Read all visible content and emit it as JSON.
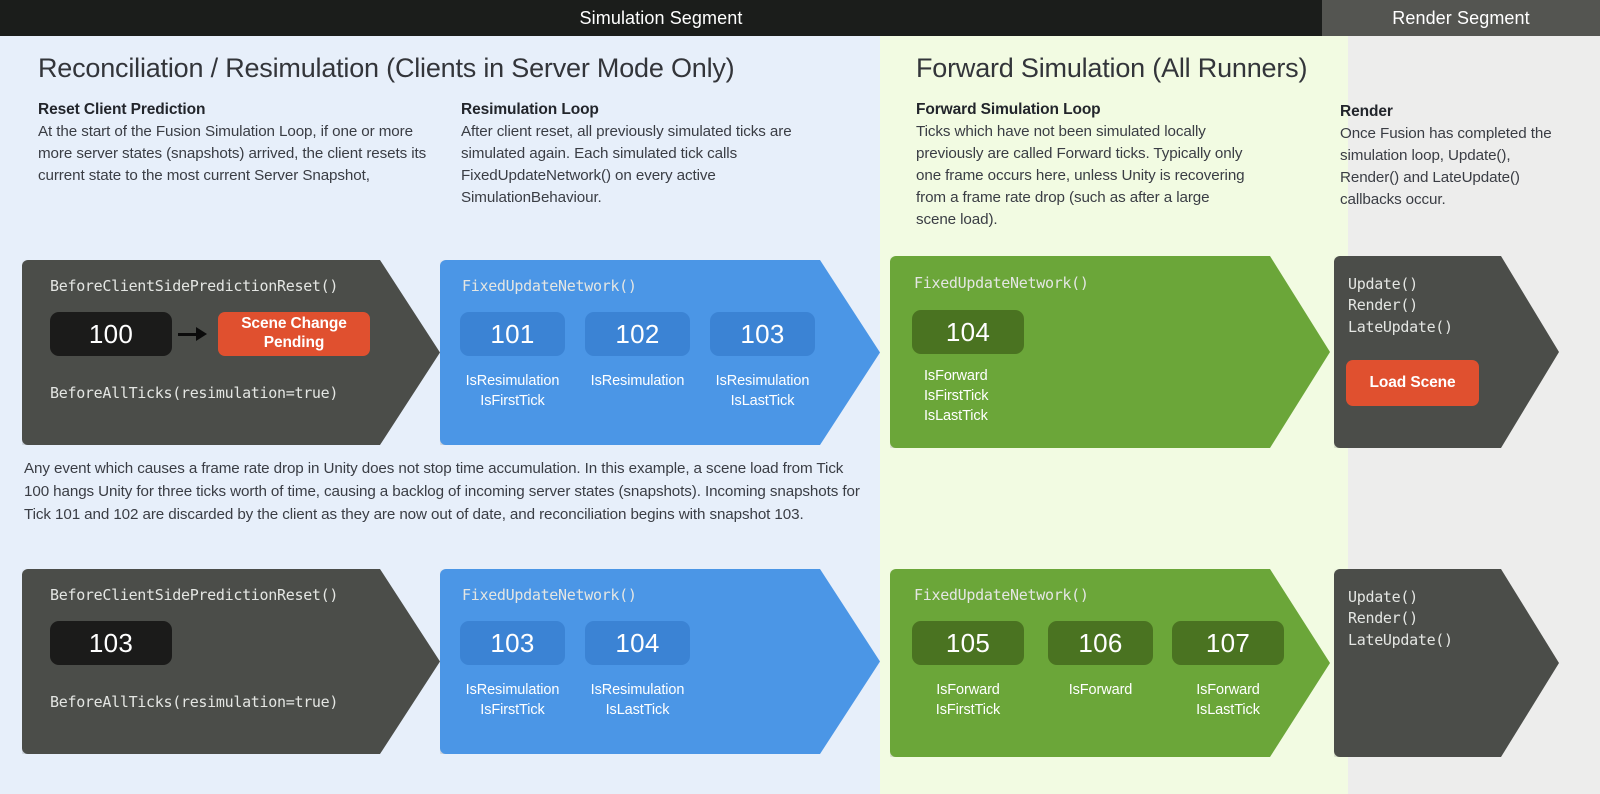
{
  "header": {
    "simulation_segment": "Simulation Segment",
    "render_segment": "Render Segment"
  },
  "columns": {
    "reconciliation": {
      "title": "Reconciliation / Resimulation (Clients in Server Mode Only)",
      "blurbs": [
        {
          "heading": "Reset Client Prediction",
          "body": "At the start of the Fusion Simulation Loop, if one or more more server states (snapshots) arrived, the client resets its current state to the most current Server Snapshot,"
        },
        {
          "heading": "Resimulation Loop",
          "body": "After client reset, all previously simulated ticks are simulated again. Each simulated tick calls FixedUpdateNetwork() on every active SimulationBehaviour."
        }
      ]
    },
    "forward": {
      "title": "Forward Simulation (All Runners)",
      "blurbs": [
        {
          "heading": "Forward Simulation Loop",
          "body": "Ticks which have not been simulated locally previously are called Forward ticks. Typically only one frame occurs here, unless Unity is recovering from a frame rate drop (such as after a large scene load)."
        }
      ]
    },
    "render": {
      "blurbs": [
        {
          "heading": "Render",
          "body": "Once Fusion has completed the simulation loop, Update(), Render() and LateUpdate() callbacks occur."
        }
      ]
    }
  },
  "row1": {
    "reset": {
      "callback_top": "BeforeClientSidePredictionReset()",
      "tick": "100",
      "pill": "Scene Change\nPending",
      "pill_line1": "Scene Change",
      "pill_line2": "Pending",
      "callback_bottom": "BeforeAllTicks(resimulation=true)"
    },
    "resim": {
      "callback": "FixedUpdateNetwork()",
      "ticks": [
        {
          "value": "101",
          "flags": "IsResimulation\nIsFirstTick",
          "flag_lines": [
            "IsResimulation",
            "IsFirstTick"
          ]
        },
        {
          "value": "102",
          "flags": "IsResimulation",
          "flag_lines": [
            "IsResimulation"
          ]
        },
        {
          "value": "103",
          "flags": "IsResimulation\nIsLastTick",
          "flag_lines": [
            "IsResimulation",
            "IsLastTick"
          ]
        }
      ]
    },
    "forward": {
      "callback": "FixedUpdateNetwork()",
      "ticks": [
        {
          "value": "104",
          "flag_lines": [
            "IsForward",
            "IsFirstTick",
            "IsLastTick"
          ]
        }
      ]
    },
    "render": {
      "calls": [
        "Update()",
        "Render()",
        "LateUpdate()"
      ],
      "pill": "Load Scene"
    }
  },
  "midnote": "Any event which causes a frame rate drop in Unity does not stop time accumulation. In this example, a scene load from Tick 100 hangs Unity for three ticks worth of time, causing a backlog of incoming server states (snapshots). Incoming snapshots for Tick 101 and 102 are discarded by the client as they are now out of date, and reconciliation begins with snapshot 103.",
  "row2": {
    "reset": {
      "callback_top": "BeforeClientSidePredictionReset()",
      "tick": "103",
      "callback_bottom": "BeforeAllTicks(resimulation=true)"
    },
    "resim": {
      "callback": "FixedUpdateNetwork()",
      "ticks": [
        {
          "value": "103",
          "flag_lines": [
            "IsResimulation",
            "IsFirstTick"
          ]
        },
        {
          "value": "104",
          "flag_lines": [
            "IsResimulation",
            "IsLastTick"
          ]
        }
      ]
    },
    "forward": {
      "callback": "FixedUpdateNetwork()",
      "ticks": [
        {
          "value": "105",
          "flag_lines": [
            "IsForward",
            "IsFirstTick"
          ]
        },
        {
          "value": "106",
          "flag_lines": [
            "IsForward"
          ]
        },
        {
          "value": "107",
          "flag_lines": [
            "IsForward",
            "IsLastTick"
          ]
        }
      ]
    },
    "render": {
      "calls": [
        "Update()",
        "Render()",
        "LateUpdate()"
      ]
    }
  },
  "colors": {
    "panel_blue": "#e7effa",
    "panel_green": "#f2fbe2",
    "panel_gray": "#ededec",
    "header_dark": "#1b1d1b",
    "header_gray": "#545551",
    "arrow_dark": "#4b4d49",
    "arrow_blue": "#4b96e6",
    "arrow_green": "#6ba639",
    "accent_red": "#e0502f"
  }
}
